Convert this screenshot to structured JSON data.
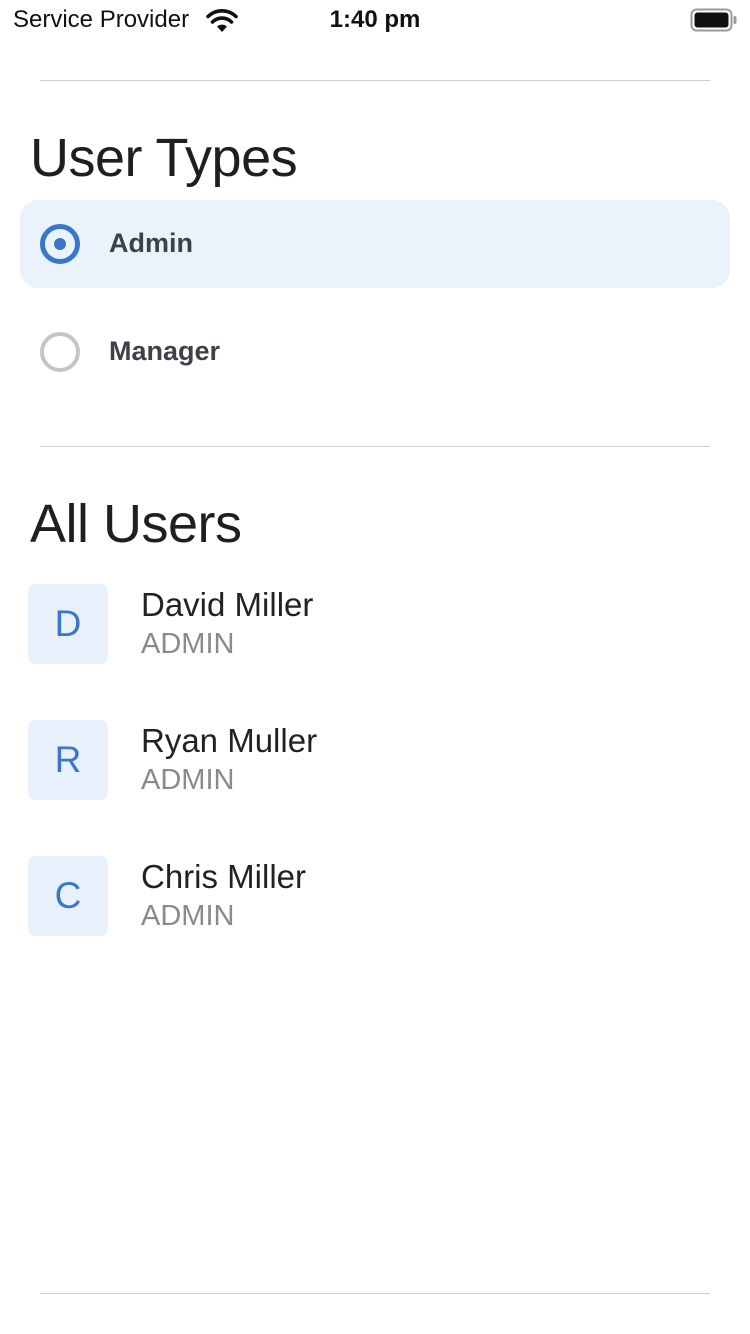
{
  "status_bar": {
    "carrier": "Service Provider",
    "time": "1:40 pm",
    "wifi_icon": "wifi-icon",
    "battery_icon": "battery-icon"
  },
  "user_types": {
    "title": "User Types",
    "options": [
      {
        "label": "Admin",
        "selected": true
      },
      {
        "label": "Manager",
        "selected": false
      }
    ]
  },
  "all_users": {
    "title": "All Users",
    "users": [
      {
        "initial": "D",
        "name": "David Miller",
        "role": "ADMIN"
      },
      {
        "initial": "R",
        "name": "Ryan Muller",
        "role": "ADMIN"
      },
      {
        "initial": "C",
        "name": "Chris Miller",
        "role": "ADMIN"
      }
    ]
  },
  "colors": {
    "accent": "#3a76c9",
    "selected_background": "#eaf2fb",
    "avatar_background": "#e8f1fb",
    "divider": "#cfcfcf",
    "secondary_text": "#8a8a8a"
  }
}
